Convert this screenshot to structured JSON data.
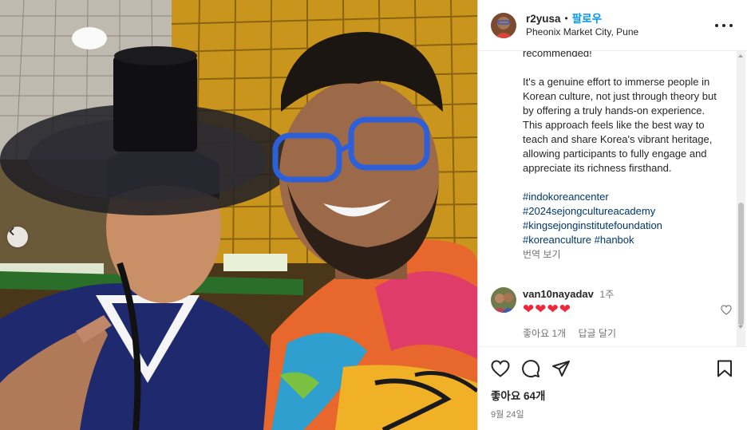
{
  "post": {
    "username": "r2yusa",
    "separator": "•",
    "follow_label": "팔로우",
    "location": "Pheonix Market City, Pune"
  },
  "caption": {
    "paragraph1": "recommended!",
    "paragraph2": "It's a genuine effort to immerse people in Korean culture, not just through theory but by offering a truly hands-on experience. This approach feels like the best way to teach and share Korea's vibrant heritage, allowing participants to fully engage and appreciate its richness firsthand.",
    "hashtags": [
      "#indokoreancenter",
      "#2024sejongcultureacademy",
      "#kingsejonginstitutefoundation",
      "#koreanculture",
      "#hanbok"
    ],
    "translate_label": "번역 보기"
  },
  "comment": {
    "username": "van10nayadav",
    "time": "1주",
    "text": "❤❤❤❤",
    "likes_label": "좋아요 1개",
    "reply_label": "답글 달기"
  },
  "actions": {
    "likes_count": "좋아요 64개",
    "date": "9월 24일"
  },
  "icons": [
    "chevron-left-icon",
    "more-options-icon",
    "heart-icon",
    "comment-icon",
    "share-icon",
    "bookmark-icon"
  ],
  "colors": {
    "link": "#00376b",
    "follow": "#0095f6",
    "heart": "#ed2a3c",
    "muted": "#737373"
  }
}
